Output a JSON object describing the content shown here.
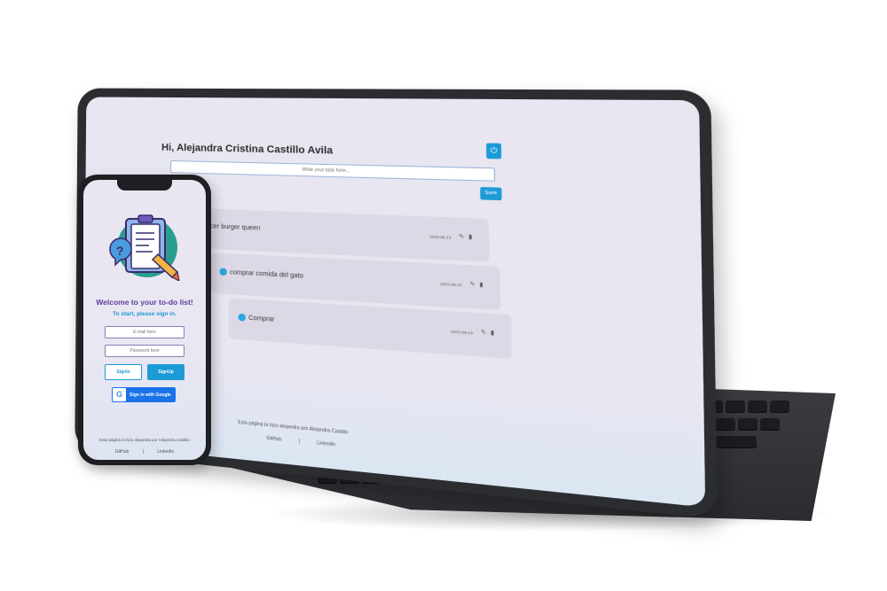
{
  "tablet": {
    "greeting": "Hi, Alejandra Cristina Castillo Avila",
    "logout_icon": "logout-icon",
    "input_placeholder": "Write your task here...",
    "save_label": "Save",
    "tasks": [
      {
        "text": "hacer burger queen",
        "date": "2022-06-13",
        "checked": false
      },
      {
        "text": "comprar comida del gato",
        "date": "2022-06-13",
        "checked": true
      },
      {
        "text": "Comprar",
        "date": "2022-06-13",
        "checked": true
      }
    ],
    "footer_text": "Esta página la hizo alejandra por Alejandra Castillo",
    "footer_links": [
      "GitHub",
      "LinkedIn"
    ]
  },
  "phone": {
    "title": "Welcome to your to-do list!",
    "subtitle": "To start, please sign in.",
    "email_placeholder": "E-mail here",
    "password_placeholder": "Password here",
    "signin_label": "SignIn",
    "signup_label": "SignUp",
    "google_label": "Sign in with Google",
    "footer_text": "Esta página la hizo alejandra por Alejandra Castillo",
    "footer_links": [
      "GitHub",
      "LinkedIn"
    ]
  },
  "colors": {
    "accent": "#1d9bd6",
    "title_purple": "#5b3e9e",
    "background": "#e9e6f1"
  }
}
